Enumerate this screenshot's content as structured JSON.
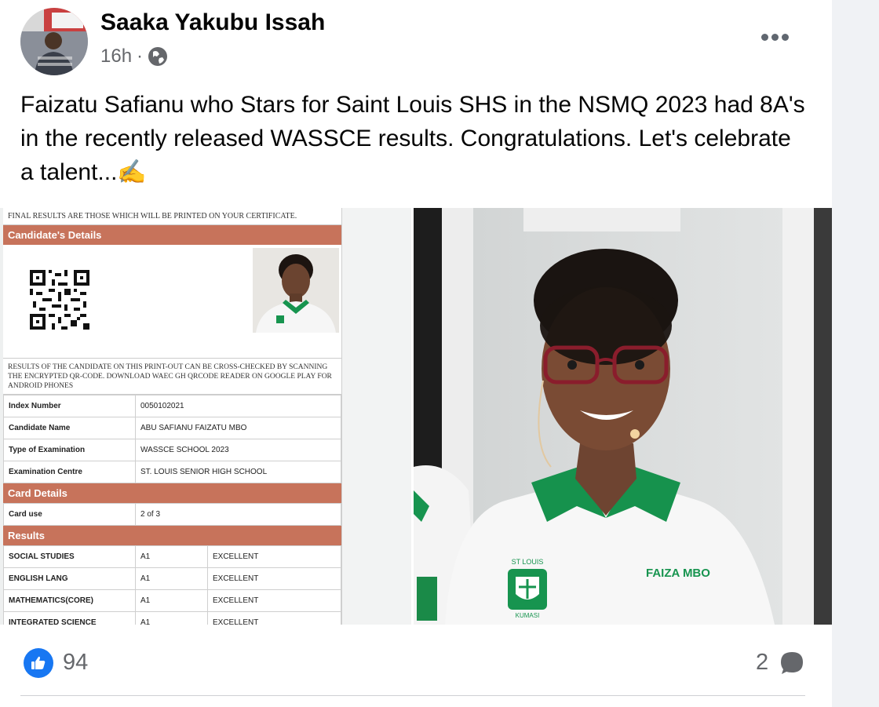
{
  "post": {
    "author": "Saaka Yakubu Issah",
    "time": "16h",
    "separator": "·",
    "caption": "Faizatu Safianu who Stars for Saint Louis SHS in the NSMQ 2023 had 8A's in the recently released WASSCE results. Congratulations. Let's celebrate a talent...✍️"
  },
  "result_slip": {
    "top_note": "FINAL RESULTS ARE THOSE WHICH WILL BE PRINTED ON YOUR CERTIFICATE.",
    "candidate_header": "Candidate's Details",
    "verify_note": "RESULTS OF THE CANDIDATE ON THIS PRINT-OUT CAN BE CROSS-CHECKED BY SCANNING THE ENCRYPTED QR-CODE. DOWNLOAD WAEC GH QRCODE READER ON GOOGLE PLAY FOR ANDROID PHONES",
    "details": [
      {
        "label": "Index Number",
        "value": "0050102021"
      },
      {
        "label": "Candidate Name",
        "value": "ABU SAFIANU FAIZATU MBO"
      },
      {
        "label": "Type of Examination",
        "value": "WASSCE SCHOOL 2023"
      },
      {
        "label": "Examination Centre",
        "value": "ST. LOUIS SENIOR HIGH SCHOOL"
      }
    ],
    "card_header": "Card Details",
    "card": {
      "label": "Card use",
      "value": "2 of 3"
    },
    "results_header": "Results",
    "results": [
      {
        "subject": "SOCIAL STUDIES",
        "grade": "A1",
        "remark": "EXCELLENT"
      },
      {
        "subject": "ENGLISH LANG",
        "grade": "A1",
        "remark": "EXCELLENT"
      },
      {
        "subject": "MATHEMATICS(CORE)",
        "grade": "A1",
        "remark": "EXCELLENT"
      },
      {
        "subject": "INTEGRATED SCIENCE",
        "grade": "A1",
        "remark": "EXCELLENT"
      }
    ]
  },
  "photo": {
    "badge_text": "ST LOUIS",
    "badge_city": "KUMASI",
    "name_tag": "FAIZA MBO"
  },
  "footer": {
    "likes": "94",
    "comments": "2"
  },
  "colors": {
    "like_blue": "#1877f2",
    "section_header": "#c7735b",
    "uniform_green": "#0f9d58"
  }
}
